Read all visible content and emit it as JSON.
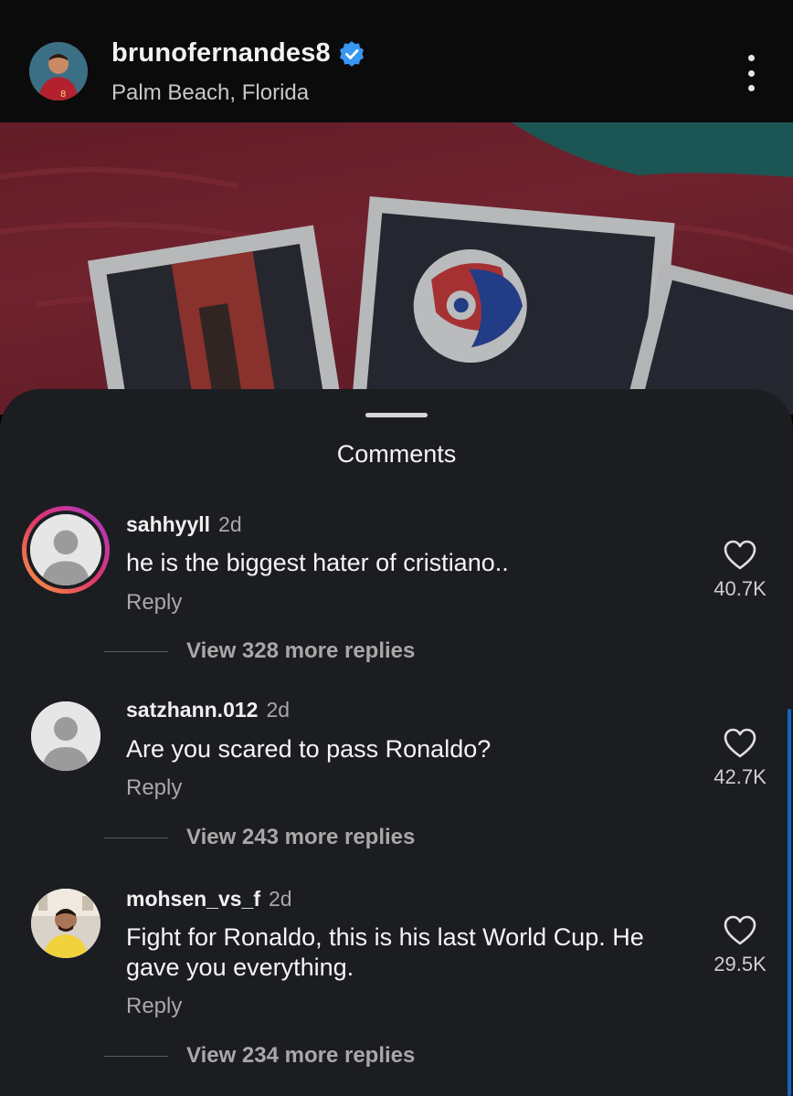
{
  "header": {
    "username": "brunofernandes8",
    "location": "Palm Beach, Florida",
    "verified_icon": "verified-badge-icon",
    "more_icon": "more-vertical-icon"
  },
  "sheet": {
    "title": "Comments"
  },
  "comments": [
    {
      "user": "sahhyyll",
      "time": "2d",
      "text": "he is the biggest hater of cristiano..",
      "reply_label": "Reply",
      "likes": "40.7K",
      "view_replies": "View 328 more replies"
    },
    {
      "user": "satzhann.012",
      "time": "2d",
      "text": "Are you scared to pass Ronaldo?",
      "reply_label": "Reply",
      "likes": "42.7K",
      "view_replies": "View 243 more replies"
    },
    {
      "user": "mohsen_vs_f",
      "time": "2d",
      "text": "Fight for Ronaldo, this is his last World Cup. He gave you everything.",
      "reply_label": "Reply",
      "likes": "29.5K",
      "view_replies": "View 234 more replies"
    }
  ],
  "colors": {
    "sheet_bg": "#1b1d21",
    "verified_blue": "#3897f0",
    "story_ring": [
      "#f9a13a",
      "#e2336b",
      "#a53bd1"
    ]
  }
}
